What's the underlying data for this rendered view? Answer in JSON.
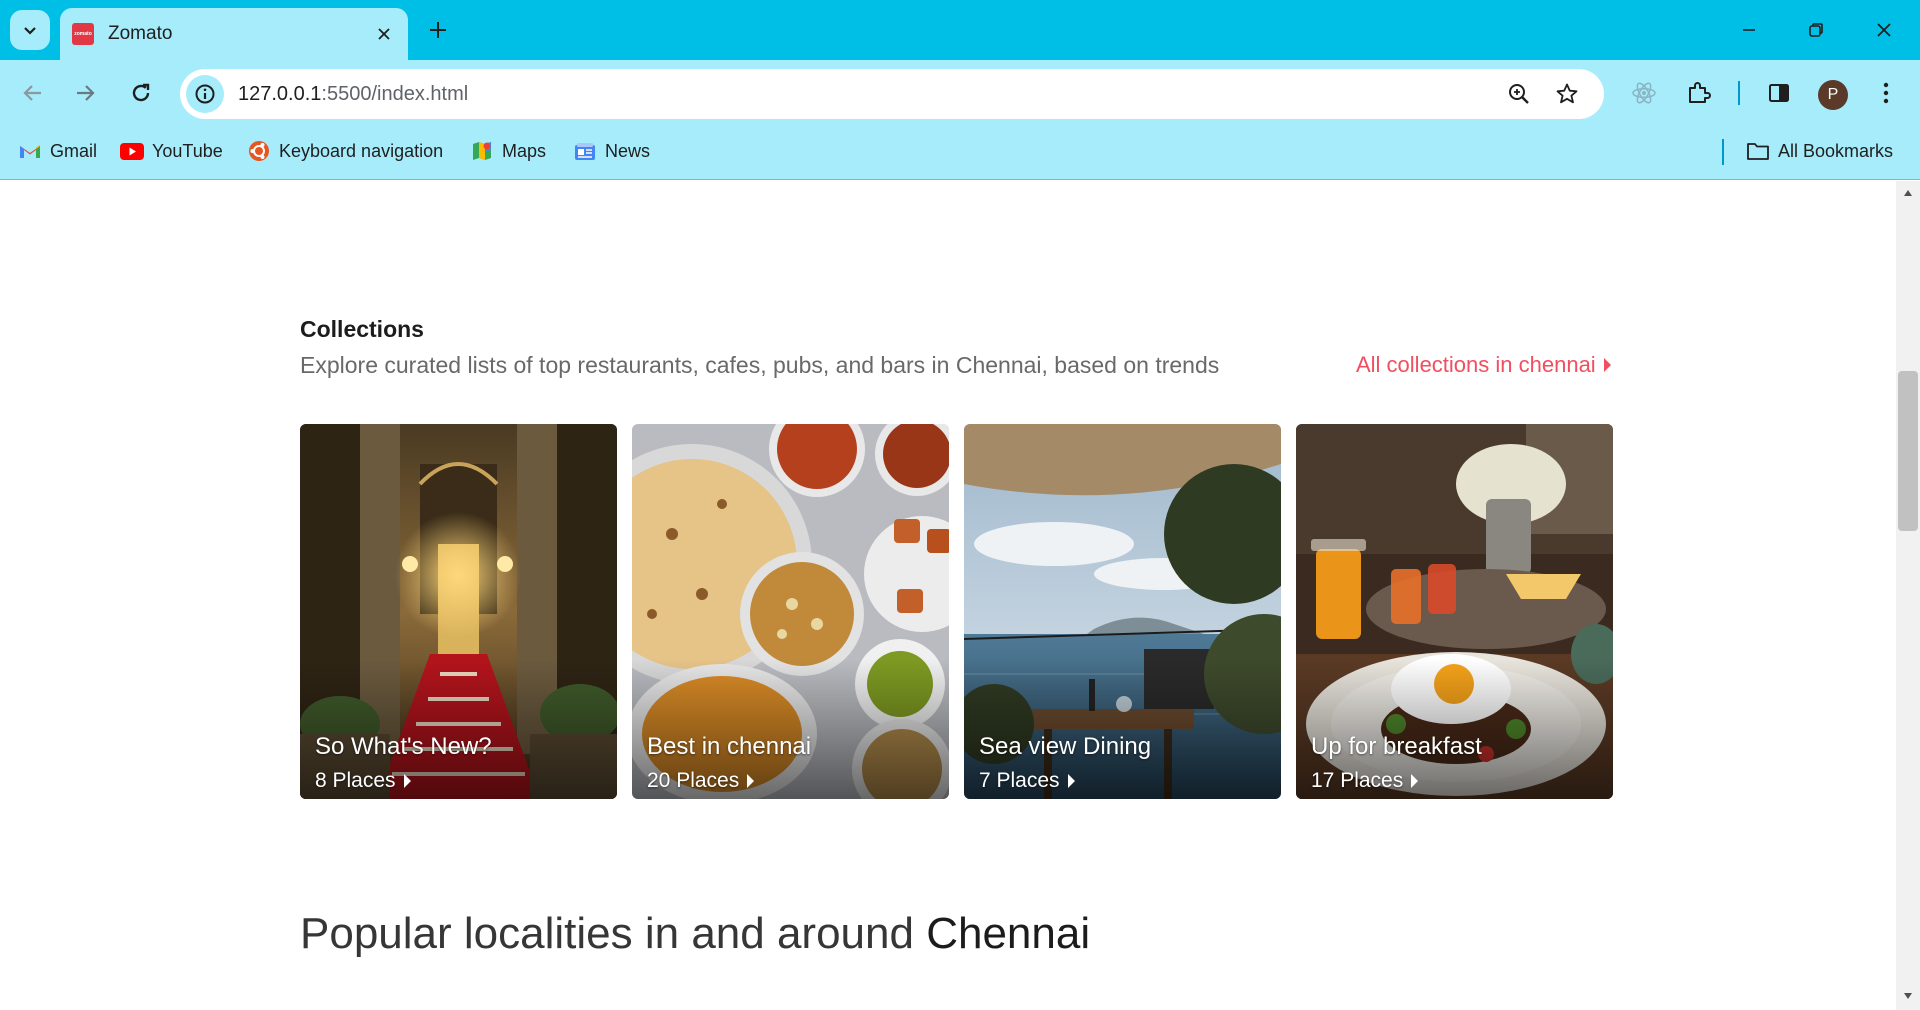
{
  "browser": {
    "tab_title": "Zomato",
    "favicon_text": "zomato",
    "url_host": "127.0.0.1",
    "url_path": ":5500/index.html",
    "profile_initial": "P",
    "bookmarks": [
      {
        "label": "Gmail",
        "icon": "gmail-icon"
      },
      {
        "label": "YouTube",
        "icon": "youtube-icon"
      },
      {
        "label": "Keyboard navigation",
        "icon": "ubuntu-icon"
      },
      {
        "label": "Maps",
        "icon": "maps-icon"
      },
      {
        "label": "News",
        "icon": "news-icon"
      }
    ],
    "all_bookmarks": "All Bookmarks",
    "colors": {
      "tabbar": "#00bfe6",
      "toolbar": "#a6ecfa"
    }
  },
  "collections": {
    "title": "Collections",
    "subtitle": "Explore curated lists of top restaurants, cafes, pubs, and bars in Chennai, based on trends",
    "link": "All collections in chennai",
    "accent": "#ef4f5f",
    "cards": [
      {
        "title": "So What's New?",
        "count": "8 Places"
      },
      {
        "title": "Best in chennai",
        "count": "20 Places"
      },
      {
        "title": "Sea view Dining",
        "count": "7 Places"
      },
      {
        "title": "Up for breakfast",
        "count": "17 Places"
      }
    ]
  },
  "popular": {
    "heading": "Popular localities in and around",
    "city": "Chennai"
  }
}
